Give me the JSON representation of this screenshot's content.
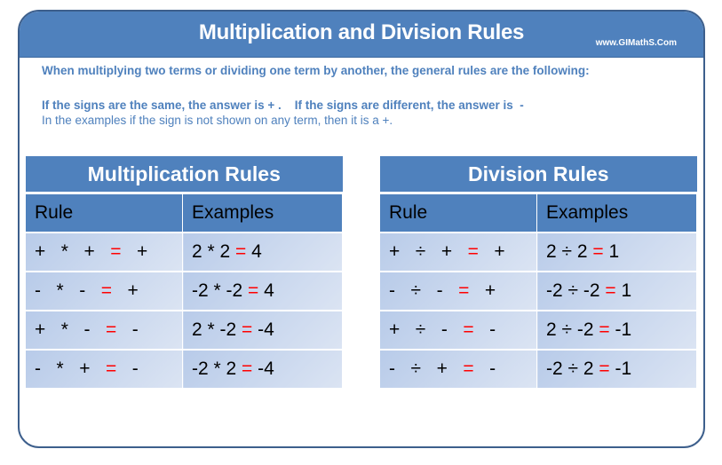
{
  "header": {
    "title": "Multiplication and Division Rules",
    "site": "www.GIMathS.Com"
  },
  "intro": {
    "line1": "When multiplying two terms or dividing one term by another, the general rules are the following:",
    "line2": "If the signs are the same, the answer is + .    If the signs are different, the answer is  -",
    "line3": "In the examples if the sign is not shown on any term, then it is a +."
  },
  "colors": {
    "accent": "#4f81bd",
    "equals": "#ff0000"
  },
  "multiplication": {
    "title": "Multiplication Rules",
    "col_rule": "Rule",
    "col_examples": "Examples",
    "rows": [
      {
        "a": "+",
        "op": "*",
        "b": "+",
        "eq": "=",
        "res": "+",
        "ex_left": "2 * 2 ",
        "ex_eq": "=",
        "ex_res": " 4"
      },
      {
        "a": "-",
        "op": "*",
        "b": "-",
        "eq": "=",
        "res": "+",
        "ex_left": "-2 * -2 ",
        "ex_eq": "=",
        "ex_res": " 4"
      },
      {
        "a": "+",
        "op": "*",
        "b": "-",
        "eq": "=",
        "res": "-",
        "ex_left": "2 * -2 ",
        "ex_eq": "=",
        "ex_res": " -4"
      },
      {
        "a": "-",
        "op": "*",
        "b": "+",
        "eq": "=",
        "res": "-",
        "ex_left": "-2 * 2 ",
        "ex_eq": "=",
        "ex_res": " -4"
      }
    ]
  },
  "division": {
    "title": "Division Rules",
    "col_rule": "Rule",
    "col_examples": "Examples",
    "rows": [
      {
        "a": "+",
        "op": "÷",
        "b": "+",
        "eq": "=",
        "res": "+",
        "ex_left": "2 ÷ 2 ",
        "ex_eq": "=",
        "ex_res": " 1"
      },
      {
        "a": "-",
        "op": "÷",
        "b": "-",
        "eq": "=",
        "res": "+",
        "ex_left": "-2 ÷ -2 ",
        "ex_eq": "=",
        "ex_res": " 1"
      },
      {
        "a": "+",
        "op": "÷",
        "b": "-",
        "eq": "=",
        "res": "-",
        "ex_left": "2 ÷ -2 ",
        "ex_eq": "=",
        "ex_res": " -1"
      },
      {
        "a": "-",
        "op": "÷",
        "b": "+",
        "eq": "=",
        "res": "-",
        "ex_left": "-2 ÷ 2 ",
        "ex_eq": "=",
        "ex_res": " -1"
      }
    ]
  }
}
